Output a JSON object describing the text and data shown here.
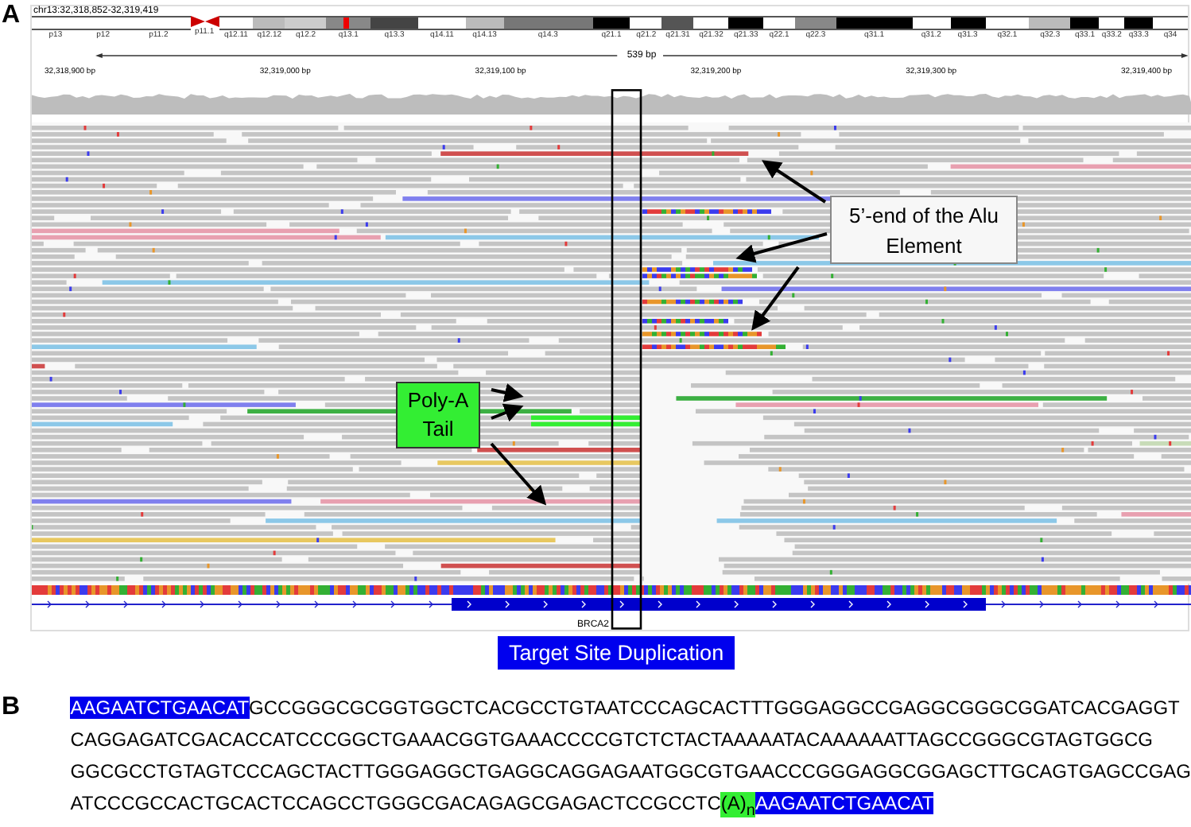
{
  "panel_a": {
    "label": "A",
    "locus": "chr13:32,318,852-32,319,419",
    "bands": [
      {
        "label": "p13",
        "color": "#ffffff",
        "kind": "band",
        "in_view": false
      },
      {
        "label": "p12",
        "color": "#ffffff",
        "kind": "band",
        "in_view": false
      },
      {
        "label": "p11.2",
        "color": "#ffffff",
        "kind": "band",
        "in_view": false
      },
      {
        "label": "p11.1",
        "color": "#cc0000",
        "kind": "centromere",
        "in_view": false
      },
      {
        "label": "q12.11",
        "color": "#ffffff",
        "kind": "band",
        "in_view": false
      },
      {
        "label": "q12.12",
        "color": "#bbbbbb",
        "kind": "band",
        "in_view": false
      },
      {
        "label": "q12.2",
        "color": "#cccccc",
        "kind": "band",
        "in_view": false
      },
      {
        "label": "q13.1",
        "color": "#888888",
        "kind": "band",
        "in_view": true
      },
      {
        "label": "q13.3",
        "color": "#444444",
        "kind": "band",
        "in_view": false
      },
      {
        "label": "q14.11",
        "color": "#ffffff",
        "kind": "band",
        "in_view": false
      },
      {
        "label": "q14.13",
        "color": "#bbbbbb",
        "kind": "band",
        "in_view": false
      },
      {
        "label": "q14.3",
        "color": "#777777",
        "kind": "band",
        "in_view": false
      },
      {
        "label": "q21.1",
        "color": "#000000",
        "kind": "band",
        "in_view": false
      },
      {
        "label": "q21.2",
        "color": "#ffffff",
        "kind": "band",
        "in_view": false
      },
      {
        "label": "q21.31",
        "color": "#555555",
        "kind": "band",
        "in_view": false
      },
      {
        "label": "q21.32",
        "color": "#ffffff",
        "kind": "band",
        "in_view": false
      },
      {
        "label": "q21.33",
        "color": "#000000",
        "kind": "band",
        "in_view": false
      },
      {
        "label": "q22.1",
        "color": "#ffffff",
        "kind": "band",
        "in_view": false
      },
      {
        "label": "q22.3",
        "color": "#888888",
        "kind": "band",
        "in_view": false
      },
      {
        "label": "q31.1",
        "color": "#000000",
        "kind": "band",
        "in_view": false
      },
      {
        "label": "q31.2",
        "color": "#ffffff",
        "kind": "band",
        "in_view": false
      },
      {
        "label": "q31.3",
        "color": "#000000",
        "kind": "band",
        "in_view": false
      },
      {
        "label": "q32.1",
        "color": "#ffffff",
        "kind": "band",
        "in_view": false
      },
      {
        "label": "q32.3",
        "color": "#bbbbbb",
        "kind": "band",
        "in_view": false
      },
      {
        "label": "q33.1",
        "color": "#000000",
        "kind": "band",
        "in_view": false
      },
      {
        "label": "q33.2",
        "color": "#ffffff",
        "kind": "band",
        "in_view": false
      },
      {
        "label": "q33.3",
        "color": "#000000",
        "kind": "band",
        "in_view": false
      },
      {
        "label": "q34",
        "color": "#ffffff",
        "kind": "band",
        "in_view": false
      }
    ],
    "span": "539 bp",
    "ruler_ticks": [
      "32,318,900 bp",
      "32,319,000 bp",
      "32,319,100 bp",
      "32,319,200 bp",
      "32,319,300 bp",
      "32,319,400 bp"
    ],
    "gene": "BRCA2",
    "callouts": [
      {
        "kind": "alu",
        "text": "5’-end of the Alu Element"
      },
      {
        "kind": "polya",
        "text": "Poly-A Tail"
      }
    ],
    "tsd_label": "Target Site Duplication"
  },
  "panel_b": {
    "label": "B",
    "lines": [
      {
        "segments": [
          {
            "kind": "tsd",
            "text": "AAGAATCTGAACAT"
          },
          {
            "kind": "plain",
            "text": "GCCGGGCGCGGTGGCTCACGCCTGTAATCCCAGCACTTTGGGAGGCCGAGGCGGGCGGATCACGAGGT"
          }
        ]
      },
      {
        "segments": [
          {
            "kind": "plain",
            "text": "CAGGAGATCGACACCATCCCGGCTGAAACGGTGAAACCCCGTCTCTACTAAAAATACAAAAAATTAGCCGGGCGTAGTGGCG"
          }
        ]
      },
      {
        "segments": [
          {
            "kind": "plain",
            "text": "GGCGCCTGTAGTCCCAGCTACTTGGGAGGCTGAGGCAGGAGAATGGCGTGAACCCGGGAGGCGGAGCTTGCAGTGAGCCGAG"
          }
        ]
      },
      {
        "segments": [
          {
            "kind": "plain",
            "text": "ATCCCGCCACTGCACTCCAGCCTGGGCGACAGAGCGAGACTCCGCCTC"
          },
          {
            "kind": "polya",
            "text": "(A)$_{n}$"
          },
          {
            "kind": "tsd",
            "text": "AAGAATCTGAACAT"
          }
        ]
      }
    ]
  }
}
